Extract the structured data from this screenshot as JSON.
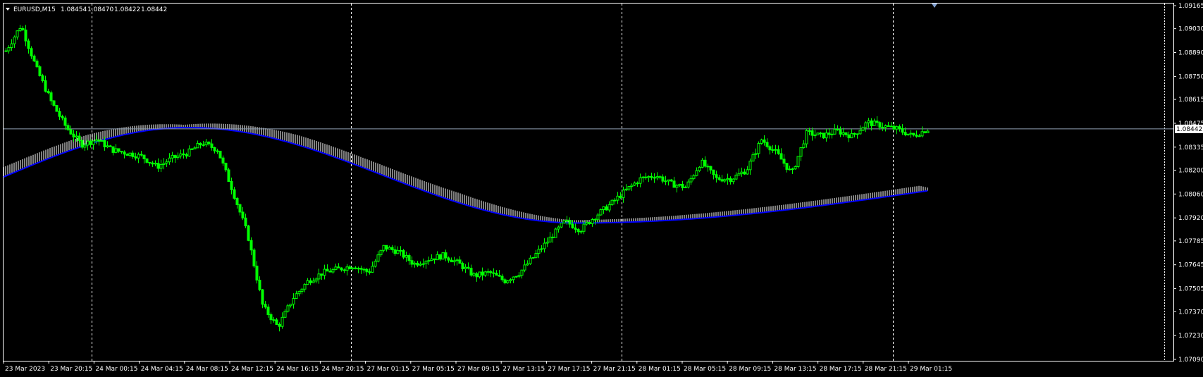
{
  "header": {
    "symbol": "EURUSD,M15",
    "open": "1.08454",
    "high": "1.08470",
    "low": "1.08422",
    "close": "1.08442"
  },
  "colors": {
    "background": "#000000",
    "bull_candle": "#00ff00",
    "bear_candle": "#00ff00",
    "ma_blue": "#0000ff",
    "ma_histogram": "#ffffff",
    "grid_period_separator": "#ffffff",
    "bid_line": "#8fa0b4",
    "axis_text": "#ffffff"
  },
  "price_axis": {
    "labels": [
      "1.09165",
      "1.09030",
      "1.08890",
      "1.08750",
      "1.08615",
      "1.08475",
      "1.08335",
      "1.08200",
      "1.08060",
      "1.07920",
      "1.07785",
      "1.07645",
      "1.07505",
      "1.07370",
      "1.07230",
      "1.07090"
    ],
    "current_price": "1.08442"
  },
  "time_axis": {
    "labels": [
      "23 Mar 2023",
      "23 Mar 20:15",
      "24 Mar 00:15",
      "24 Mar 04:15",
      "24 Mar 08:15",
      "24 Mar 12:15",
      "24 Mar 16:15",
      "24 Mar 20:15",
      "27 Mar 01:15",
      "27 Mar 05:15",
      "27 Mar 09:15",
      "27 Mar 13:15",
      "27 Mar 17:15",
      "27 Mar 21:15",
      "28 Mar 01:15",
      "28 Mar 05:15",
      "28 Mar 09:15",
      "28 Mar 13:15",
      "28 Mar 17:15",
      "28 Mar 21:15",
      "29 Mar 01:15"
    ]
  },
  "chart_data": {
    "type": "candlestick",
    "symbol": "EURUSD",
    "timeframe": "M15",
    "ylim": [
      1.0709,
      1.09165
    ],
    "close_path": [
      [
        0,
        1.089
      ],
      [
        1,
        1.0905
      ],
      [
        2,
        1.088
      ],
      [
        3,
        1.086
      ],
      [
        4,
        1.0845
      ],
      [
        5,
        1.0835
      ],
      [
        6,
        1.0838
      ],
      [
        7,
        1.0832
      ],
      [
        8,
        1.083
      ],
      [
        9,
        1.0828
      ],
      [
        10,
        1.0822
      ],
      [
        11,
        1.0827
      ],
      [
        12,
        1.083
      ],
      [
        13,
        1.0836
      ],
      [
        14,
        1.0832
      ],
      [
        15,
        1.0808
      ],
      [
        16,
        1.0782
      ],
      [
        17,
        1.074
      ],
      [
        18,
        1.0728
      ],
      [
        19,
        1.0745
      ],
      [
        20,
        1.0755
      ],
      [
        21,
        1.076
      ],
      [
        22,
        1.0762
      ],
      [
        23,
        1.0764
      ],
      [
        24,
        1.076
      ],
      [
        25,
        1.0775
      ],
      [
        26,
        1.0772
      ],
      [
        27,
        1.0765
      ],
      [
        28,
        1.0768
      ],
      [
        29,
        1.077
      ],
      [
        30,
        1.0765
      ],
      [
        31,
        1.0758
      ],
      [
        32,
        1.076
      ],
      [
        33,
        1.0755
      ],
      [
        34,
        1.076
      ],
      [
        35,
        1.077
      ],
      [
        36,
        1.078
      ],
      [
        37,
        1.079
      ],
      [
        38,
        1.0785
      ],
      [
        39,
        1.0793
      ],
      [
        40,
        1.08
      ],
      [
        41,
        1.0808
      ],
      [
        42,
        1.0815
      ],
      [
        43,
        1.0817
      ],
      [
        44,
        1.0812
      ],
      [
        45,
        1.081
      ],
      [
        46,
        1.0825
      ],
      [
        47,
        1.0815
      ],
      [
        48,
        1.0815
      ],
      [
        49,
        1.082
      ],
      [
        50,
        1.0838
      ],
      [
        51,
        1.083
      ],
      [
        52,
        1.0818
      ],
      [
        53,
        1.0842
      ],
      [
        54,
        1.084
      ],
      [
        55,
        1.0843
      ],
      [
        56,
        1.084
      ],
      [
        57,
        1.0848
      ],
      [
        58,
        1.0846
      ],
      [
        59,
        1.0844
      ],
      [
        60,
        1.084
      ],
      [
        61,
        1.0844
      ]
    ],
    "moving_average": {
      "from_price": 1.0816,
      "peak_price": 1.0845,
      "trough_price": 1.0789,
      "to_price": 1.0808
    },
    "last_price": 1.08442
  }
}
